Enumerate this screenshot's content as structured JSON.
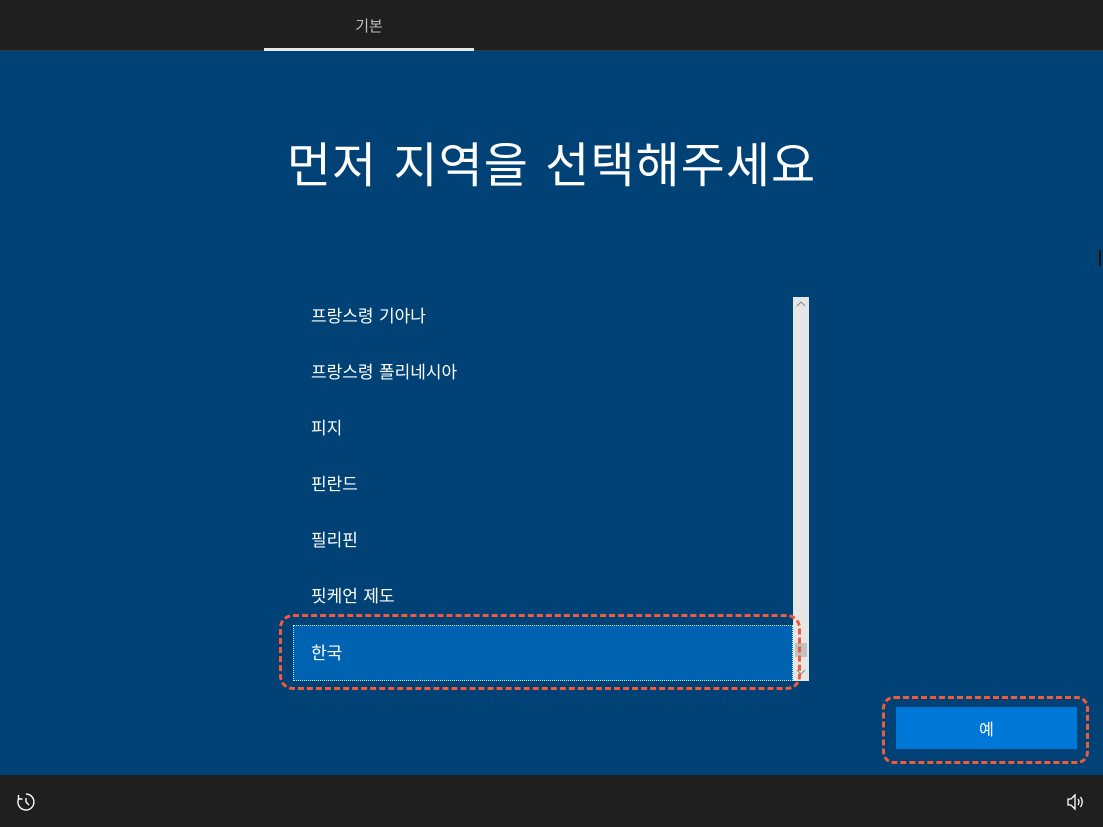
{
  "header": {
    "tab_label": "기본"
  },
  "main": {
    "title": "먼저 지역을 선택해주세요",
    "regions": [
      "프랑스령 기아나",
      "프랑스령 폴리네시아",
      "피지",
      "핀란드",
      "필리핀",
      "핏케언 제도",
      "한국"
    ],
    "selected_region": "한국",
    "confirm_label": "예"
  },
  "footer": {
    "left_icon": "ease-of-access-icon",
    "right_icon": "volume-icon"
  },
  "colors": {
    "background": "#004275",
    "selection": "#0063b1",
    "button": "#0078d7",
    "annotation": "#f15a3a"
  }
}
